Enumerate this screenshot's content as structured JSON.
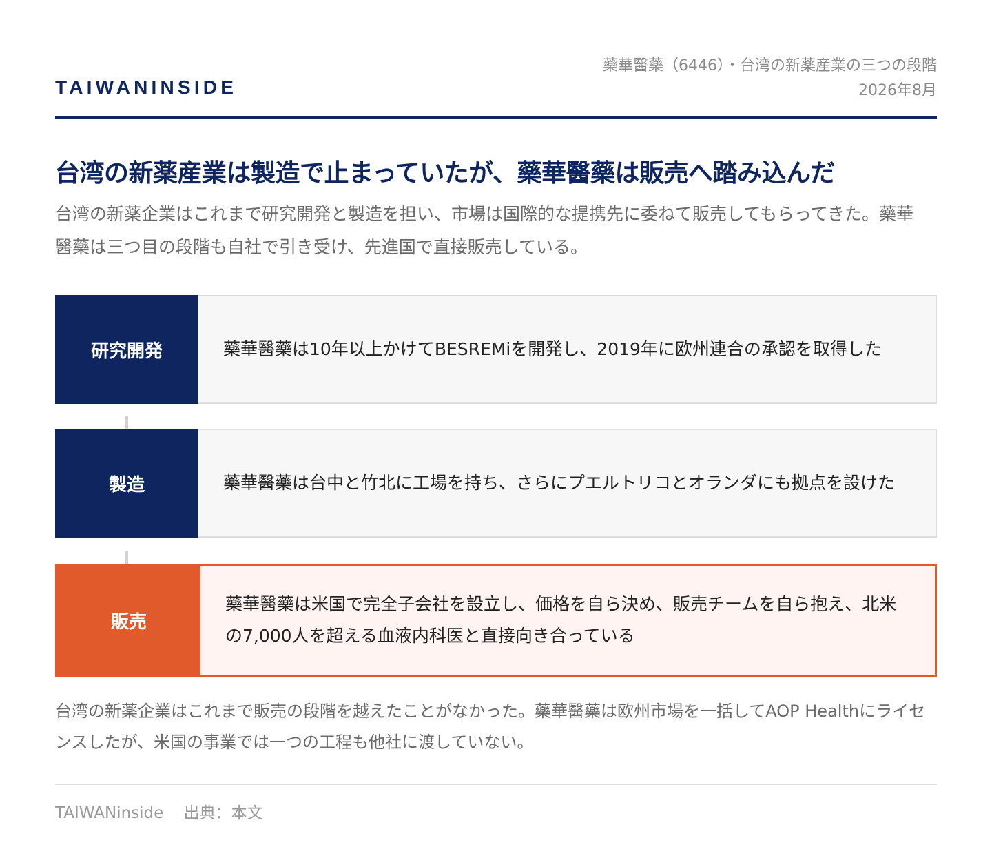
{
  "header": {
    "brand": "TAIWANINSIDE",
    "meta_line1": "藥華醫藥（6446）・台湾の新薬産業の三つの段階",
    "meta_line2": "2026年8月"
  },
  "headline": "台湾の新薬産業は製造で止まっていたが、藥華醫藥は販売へ踏み込んだ",
  "lead": "台湾の新薬企業はこれまで研究開発と製造を担い、市場は国際的な提携先に委ねて販売してもらってきた。藥華醫藥は三つ目の段階も自社で引き受け、先進国で直接販売している。",
  "stages": [
    {
      "label": "研究開発",
      "text": "藥華醫藥は10年以上かけてBESREMiを開発し、2019年に欧州連合の承認を取得した"
    },
    {
      "label": "製造",
      "text": "藥華醫藥は台中と竹北に工場を持ち、さらにプエルトリコとオランダにも拠点を設けた"
    },
    {
      "label": "販売",
      "text": "藥華醫藥は米国で完全子会社を設立し、価格を自ら決め、販売チームを自ら抱え、北米の7,000人を超える血液内科医と直接向き合っている"
    }
  ],
  "colors": {
    "navy": "#0f2560",
    "accent": "#e05a2b"
  },
  "closing": "台湾の新薬企業はこれまで販売の段階を越えたことがなかった。藥華醫藥は欧州市場を一括してAOP Healthにライセンスしたが、米国の事業では一つの工程も他社に渡していない。",
  "footer": {
    "source_brand": "TAIWANinside",
    "source_label": "出典：本文"
  }
}
